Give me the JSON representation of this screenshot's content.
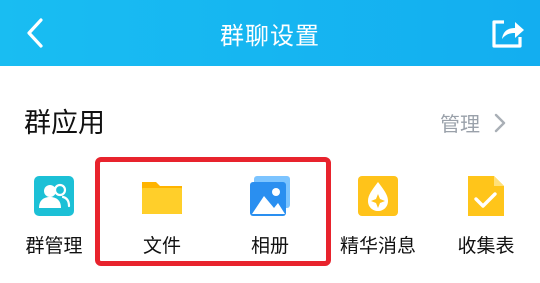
{
  "header": {
    "title": "群聊设置",
    "background": "#16b6f1",
    "back_icon": "chevron-left-icon",
    "share_icon": "share-icon"
  },
  "section": {
    "title": "群应用",
    "manage_label": "管理"
  },
  "apps": [
    {
      "label": "群管理",
      "icon": "group-manage-icon",
      "color": "#1cc0d6"
    },
    {
      "label": "文件",
      "icon": "folder-icon",
      "color": "#ffc51a"
    },
    {
      "label": "相册",
      "icon": "photo-album-icon",
      "color": "#2a8ff0"
    },
    {
      "label": "精华消息",
      "icon": "essence-message-icon",
      "color": "#ffc31a"
    },
    {
      "label": "收集表",
      "icon": "collection-form-icon",
      "color": "#ffc51a"
    }
  ],
  "highlight_color": "#e8232d"
}
